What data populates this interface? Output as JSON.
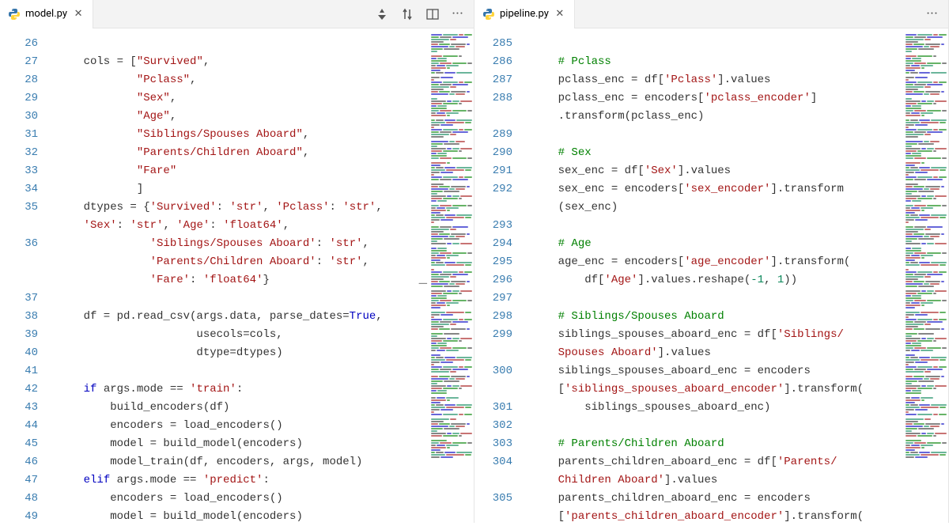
{
  "panes": [
    {
      "tab": {
        "icon": "python-icon",
        "label": "model.py",
        "dirty": false
      },
      "actions": [
        "diff-icon",
        "compare-icon",
        "split-icon",
        "more-icon"
      ],
      "startLine": 26,
      "lines": [
        {
          "n": 26,
          "segs": [
            ""
          ]
        },
        {
          "n": 27,
          "segs": [
            "    cols = [",
            {
              "t": "\"Survived\"",
              "c": "tok-str"
            },
            ","
          ]
        },
        {
          "n": 28,
          "segs": [
            "            ",
            {
              "t": "\"Pclass\"",
              "c": "tok-str"
            },
            ","
          ]
        },
        {
          "n": 29,
          "segs": [
            "            ",
            {
              "t": "\"Sex\"",
              "c": "tok-str"
            },
            ","
          ]
        },
        {
          "n": 30,
          "segs": [
            "            ",
            {
              "t": "\"Age\"",
              "c": "tok-str"
            },
            ","
          ]
        },
        {
          "n": 31,
          "segs": [
            "            ",
            {
              "t": "\"Siblings/Spouses Aboard\"",
              "c": "tok-str"
            },
            ","
          ]
        },
        {
          "n": 32,
          "segs": [
            "            ",
            {
              "t": "\"Parents/Children Aboard\"",
              "c": "tok-str"
            },
            ","
          ]
        },
        {
          "n": 33,
          "segs": [
            "            ",
            {
              "t": "\"Fare\"",
              "c": "tok-str"
            }
          ]
        },
        {
          "n": 34,
          "segs": [
            "            ]"
          ]
        },
        {
          "n": 35,
          "segs": [
            "    dtypes = {",
            {
              "t": "'Survived'",
              "c": "tok-str"
            },
            ": ",
            {
              "t": "'str'",
              "c": "tok-str"
            },
            ", ",
            {
              "t": "'Pclass'",
              "c": "tok-str"
            },
            ": ",
            {
              "t": "'str'",
              "c": "tok-str"
            },
            ","
          ]
        },
        {
          "n": "",
          "segs": [
            "    ",
            {
              "t": "'Sex'",
              "c": "tok-str"
            },
            ": ",
            {
              "t": "'str'",
              "c": "tok-str"
            },
            ", ",
            {
              "t": "'Age'",
              "c": "tok-str"
            },
            ": ",
            {
              "t": "'float64'",
              "c": "tok-str"
            },
            ","
          ]
        },
        {
          "n": 36,
          "segs": [
            "              ",
            {
              "t": "'Siblings/Spouses Aboard'",
              "c": "tok-str"
            },
            ": ",
            {
              "t": "'str'",
              "c": "tok-str"
            },
            ","
          ]
        },
        {
          "n": "",
          "segs": [
            "              ",
            {
              "t": "'Parents/Children Aboard'",
              "c": "tok-str"
            },
            ": ",
            {
              "t": "'str'",
              "c": "tok-str"
            },
            ","
          ]
        },
        {
          "n": "",
          "segs": [
            "              ",
            {
              "t": "'Fare'",
              "c": "tok-str"
            },
            ": ",
            {
              "t": "'float64'",
              "c": "tok-str"
            },
            "}"
          ]
        },
        {
          "n": 37,
          "segs": [
            ""
          ]
        },
        {
          "n": 38,
          "segs": [
            "    df = pd.read_csv(args.data, parse_dates=",
            {
              "t": "True",
              "c": "tok-const"
            },
            ","
          ]
        },
        {
          "n": 39,
          "segs": [
            "                     usecols=cols,"
          ]
        },
        {
          "n": 40,
          "segs": [
            "                     dtype=dtypes)"
          ]
        },
        {
          "n": 41,
          "segs": [
            ""
          ]
        },
        {
          "n": 42,
          "segs": [
            "    ",
            {
              "t": "if",
              "c": "tok-kw"
            },
            " args.mode == ",
            {
              "t": "'train'",
              "c": "tok-str"
            },
            ":"
          ]
        },
        {
          "n": 43,
          "segs": [
            "        build_encoders(df)"
          ]
        },
        {
          "n": 44,
          "segs": [
            "        encoders = load_encoders()"
          ]
        },
        {
          "n": 45,
          "segs": [
            "        model = build_model(encoders)"
          ]
        },
        {
          "n": 46,
          "segs": [
            "        model_train(df, encoders, args, model)"
          ]
        },
        {
          "n": 47,
          "segs": [
            "    ",
            {
              "t": "elif",
              "c": "tok-kw"
            },
            " args.mode == ",
            {
              "t": "'predict'",
              "c": "tok-str"
            },
            ":"
          ]
        },
        {
          "n": 48,
          "segs": [
            "        encoders = load_encoders()"
          ]
        },
        {
          "n": 49,
          "segs": [
            "        model = build_model(encoders)"
          ]
        }
      ]
    },
    {
      "tab": {
        "icon": "python-icon",
        "label": "pipeline.py",
        "dirty": false
      },
      "actions": [
        "more-icon"
      ],
      "startLine": 285,
      "lines": [
        {
          "n": 285,
          "segs": [
            ""
          ]
        },
        {
          "n": 286,
          "segs": [
            "    ",
            {
              "t": "# Pclass",
              "c": "tok-com"
            }
          ]
        },
        {
          "n": 287,
          "segs": [
            "    pclass_enc = df[",
            {
              "t": "'Pclass'",
              "c": "tok-str"
            },
            "].values"
          ]
        },
        {
          "n": 288,
          "segs": [
            "    pclass_enc = encoders[",
            {
              "t": "'pclass_encoder'",
              "c": "tok-str"
            },
            "]"
          ]
        },
        {
          "n": "",
          "segs": [
            "    .transform(pclass_enc)"
          ]
        },
        {
          "n": 289,
          "segs": [
            ""
          ]
        },
        {
          "n": 290,
          "segs": [
            "    ",
            {
              "t": "# Sex",
              "c": "tok-com"
            }
          ]
        },
        {
          "n": 291,
          "segs": [
            "    sex_enc = df[",
            {
              "t": "'Sex'",
              "c": "tok-str"
            },
            "].values"
          ]
        },
        {
          "n": 292,
          "segs": [
            "    sex_enc = encoders[",
            {
              "t": "'sex_encoder'",
              "c": "tok-str"
            },
            "].transform"
          ]
        },
        {
          "n": "",
          "segs": [
            "    (sex_enc)"
          ]
        },
        {
          "n": 293,
          "segs": [
            ""
          ]
        },
        {
          "n": 294,
          "segs": [
            "    ",
            {
              "t": "# Age",
              "c": "tok-com"
            }
          ]
        },
        {
          "n": 295,
          "segs": [
            "    age_enc = encoders[",
            {
              "t": "'age_encoder'",
              "c": "tok-str"
            },
            "].transform("
          ]
        },
        {
          "n": 296,
          "segs": [
            "        df[",
            {
              "t": "'Age'",
              "c": "tok-str"
            },
            "].values.reshape(",
            {
              "t": "-1",
              "c": "tok-num"
            },
            ", ",
            {
              "t": "1",
              "c": "tok-num"
            },
            "))"
          ]
        },
        {
          "n": 297,
          "segs": [
            ""
          ]
        },
        {
          "n": 298,
          "segs": [
            "    ",
            {
              "t": "# Siblings/Spouses Aboard",
              "c": "tok-com"
            }
          ]
        },
        {
          "n": 299,
          "segs": [
            "    siblings_spouses_aboard_enc = df[",
            {
              "t": "'Siblings/",
              "c": "tok-str"
            }
          ]
        },
        {
          "n": "",
          "segs": [
            "    ",
            {
              "t": "Spouses Aboard'",
              "c": "tok-str"
            },
            "].values"
          ]
        },
        {
          "n": 300,
          "segs": [
            "    siblings_spouses_aboard_enc = encoders"
          ]
        },
        {
          "n": "",
          "segs": [
            "    [",
            {
              "t": "'siblings_spouses_aboard_encoder'",
              "c": "tok-str"
            },
            "].transform("
          ]
        },
        {
          "n": 301,
          "segs": [
            "        siblings_spouses_aboard_enc)"
          ]
        },
        {
          "n": 302,
          "segs": [
            ""
          ]
        },
        {
          "n": 303,
          "segs": [
            "    ",
            {
              "t": "# Parents/Children Aboard",
              "c": "tok-com"
            }
          ]
        },
        {
          "n": 304,
          "segs": [
            "    parents_children_aboard_enc = df[",
            {
              "t": "'Parents/",
              "c": "tok-str"
            }
          ]
        },
        {
          "n": "",
          "segs": [
            "    ",
            {
              "t": "Children Aboard'",
              "c": "tok-str"
            },
            "].values"
          ]
        },
        {
          "n": 305,
          "segs": [
            "    parents_children_aboard_enc = encoders"
          ]
        },
        {
          "n": "",
          "segs": [
            "    [",
            {
              "t": "'parents_children_aboard_encoder'",
              "c": "tok-str"
            },
            "].transform("
          ]
        }
      ]
    }
  ],
  "icons": {
    "python-icon": "py",
    "diff-icon": "◆",
    "compare-icon": "⇅",
    "split-icon": "▥",
    "more-icon": "···",
    "close-icon": "✕"
  },
  "minimap_colors": [
    "#a31515",
    "#008000",
    "#333",
    "#0000c0",
    "#098658"
  ]
}
